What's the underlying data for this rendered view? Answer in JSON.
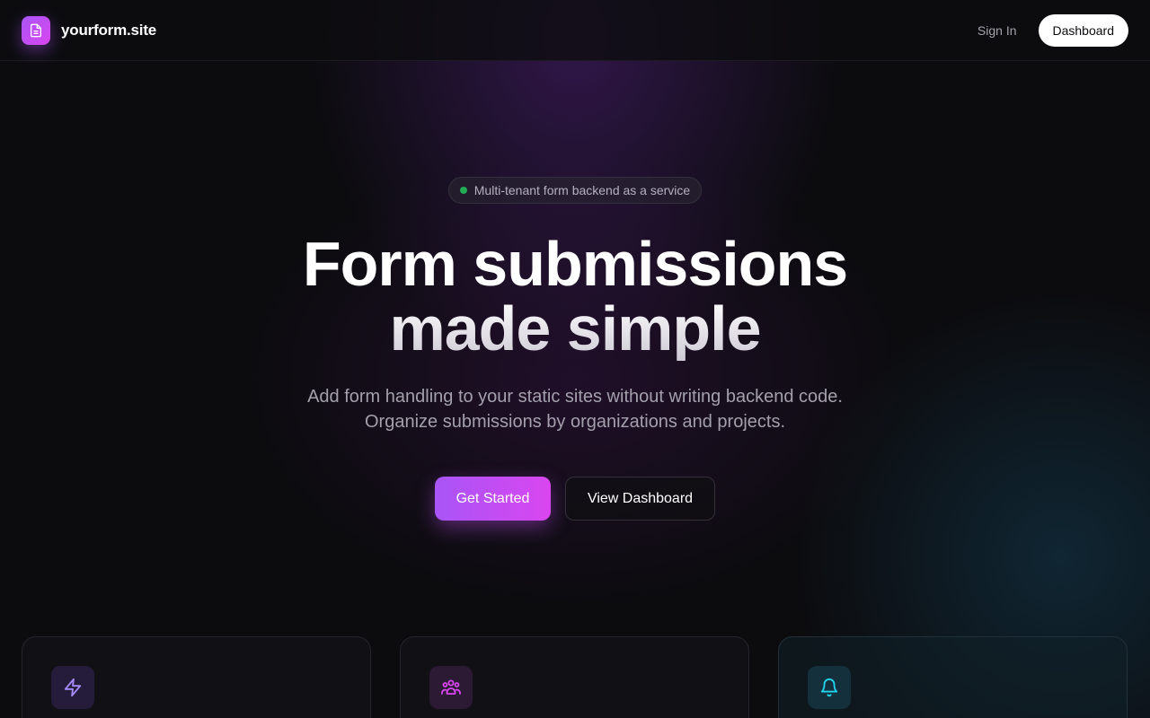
{
  "header": {
    "brand_name": "yourform.site",
    "logo_icon": "document-icon",
    "sign_in_label": "Sign In",
    "dashboard_label": "Dashboard"
  },
  "hero": {
    "badge_text": "Multi-tenant form backend as a service",
    "title_line1": "Form submissions",
    "title_line2": "made simple",
    "subtitle_line1": "Add form handling to your static sites without writing backend code.",
    "subtitle_line2": "Organize submissions by organizations and projects.",
    "primary_cta": "Get Started",
    "secondary_cta": "View Dashboard"
  },
  "features": [
    {
      "icon": "lightning-icon",
      "color": "#a78bfa"
    },
    {
      "icon": "users-icon",
      "color": "#d946ef"
    },
    {
      "icon": "bell-icon",
      "color": "#22d3ee"
    }
  ],
  "colors": {
    "background": "#0c0c0f",
    "accent_start": "#a855f7",
    "accent_end": "#d946ef",
    "badge_dot": "#22c55e"
  }
}
